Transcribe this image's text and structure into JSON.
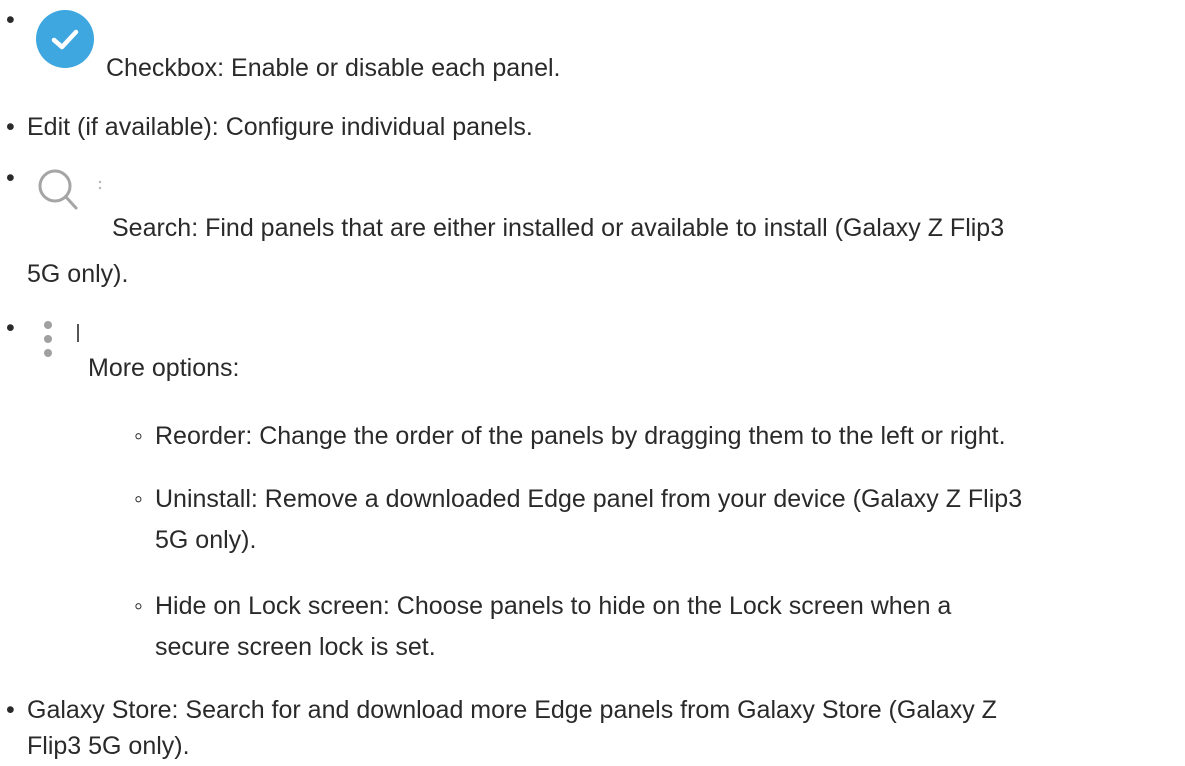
{
  "bullet": "•",
  "sub_bullet": "◦",
  "items": {
    "checkbox": {
      "icon": "checkbox-checked-icon",
      "text": "Checkbox: Enable or disable each panel."
    },
    "edit": {
      "text": "Edit (if available): Configure individual panels."
    },
    "search": {
      "icon": "search-icon",
      "line1": "Search: Find panels that are either installed or available to install (Galaxy Z Flip3",
      "line2": "5G only)."
    },
    "more": {
      "icon": "more-options-icon",
      "text": "More options:",
      "sub": {
        "reorder": "Reorder: Change the order of the panels by dragging them to the left or right.",
        "uninstall_l1": "Uninstall: Remove a downloaded Edge panel from your device (Galaxy Z Flip3",
        "uninstall_l2": "5G only).",
        "hide_l1": "Hide on Lock screen: Choose panels to hide on the Lock screen when a",
        "hide_l2": "secure screen lock is set."
      }
    },
    "store": {
      "line1": "Galaxy Store: Search for and download more Edge panels from Galaxy Store (Galaxy Z",
      "line2": "Flip3 5G only)."
    }
  },
  "colors": {
    "checkbox_fill": "#3ea7e0",
    "text": "#2a2a2a",
    "icon_gray": "#9a9a9a"
  }
}
